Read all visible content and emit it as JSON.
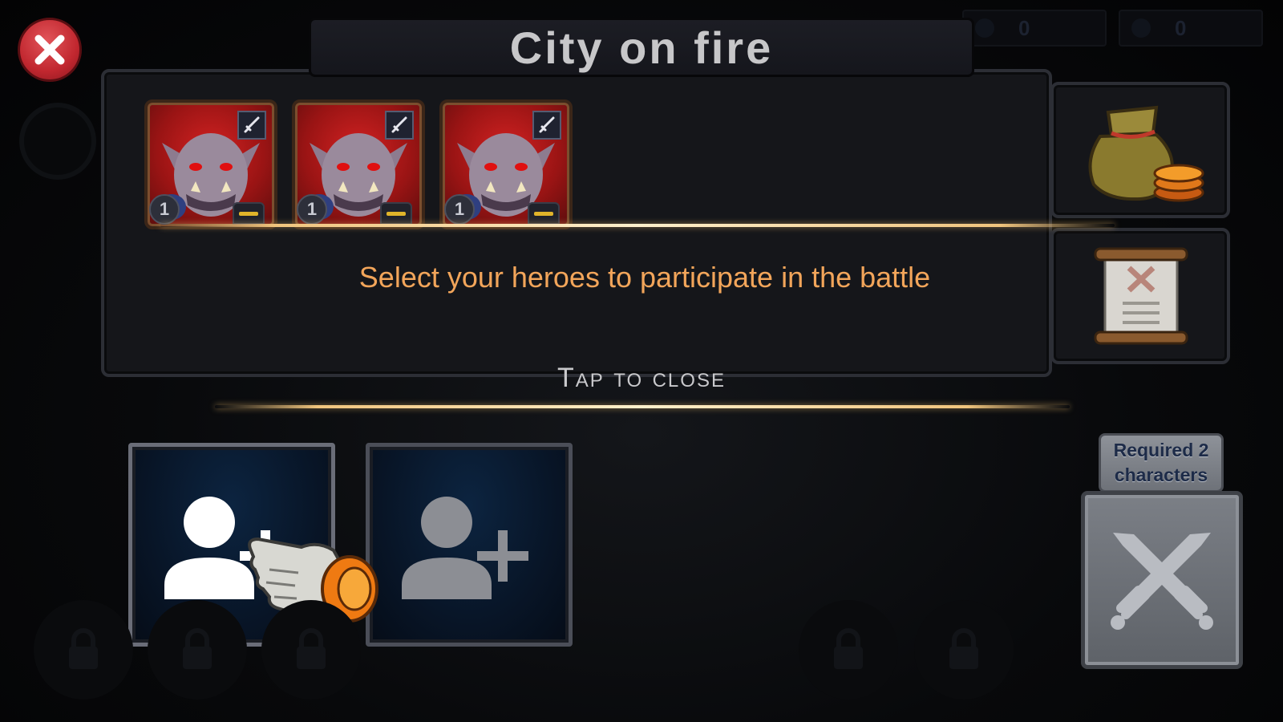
{
  "header": {
    "title": "City on fire",
    "currencies": [
      {
        "icon": "gem-icon",
        "value": "0"
      },
      {
        "icon": "energy-icon",
        "value": "0"
      }
    ]
  },
  "enemies": [
    {
      "name": "orc-enemy",
      "level": "1",
      "role_icon": "sword-icon"
    },
    {
      "name": "orc-enemy",
      "level": "1",
      "role_icon": "sword-icon"
    },
    {
      "name": "orc-enemy",
      "level": "1",
      "role_icon": "sword-icon"
    }
  ],
  "rewards": {
    "top_icon": "gold-bag-icon",
    "bottom_icon": "scroll-icon"
  },
  "tutorial": {
    "hint": "Select your heroes to participate in the battle",
    "tap_to_close": "Tap to close"
  },
  "team_slots": [
    {
      "icon": "add-hero-icon",
      "highlighted": true
    },
    {
      "icon": "add-hero-icon",
      "highlighted": false
    }
  ],
  "battle": {
    "required_label": "Required 2 characters",
    "button_icon": "crossed-swords-icon"
  },
  "colors": {
    "hint_text": "#f2a55a",
    "close_button": "#c1272f",
    "enemy_card_bg": "#d32222",
    "slot_bg": "#0c2440",
    "gold_line": "#f0c47d"
  }
}
